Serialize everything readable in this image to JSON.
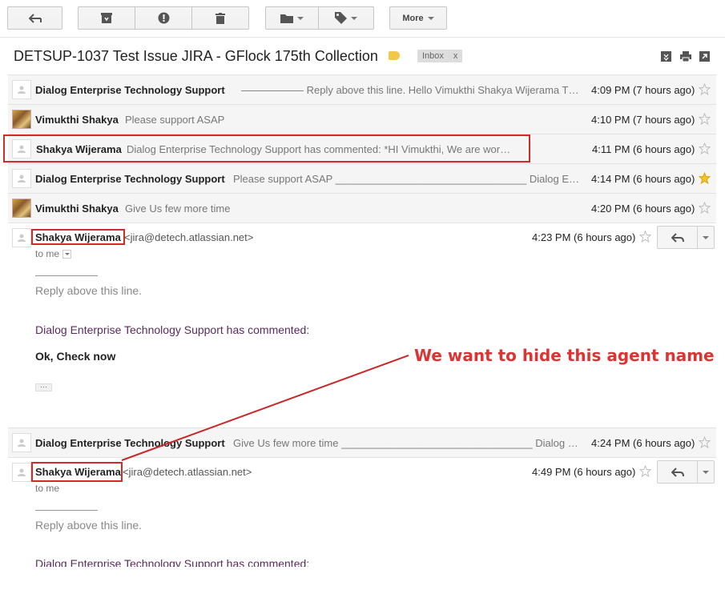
{
  "toolbar": {
    "more_label": "More"
  },
  "subject": "DETSUP-1037 Test Issue JIRA - GFlock 175th Collection",
  "label": {
    "inbox": "Inbox",
    "remove": "x"
  },
  "rows": [
    {
      "sender": "Dialog Enterprise Technology Support",
      "snippet": "—————— Reply above this line. Hello Vimukthi Shakya Wijerama Thank you for your",
      "time": "4:09 PM (7 hours ago)",
      "starred": false
    },
    {
      "sender": "Vimukthi Shakya",
      "snippet": "Please support ASAP",
      "time": "4:10 PM (7 hours ago)",
      "starred": false
    },
    {
      "sender": "Shakya Wijerama",
      "snippet": "Dialog Enterprise Technology Support has commented: *HI Vimukthi, We are working on it*",
      "time": "4:11 PM (6 hours ago)",
      "starred": false
    },
    {
      "sender": "Dialog Enterprise Technology Support",
      "snippet": "Please support ASAP _________________________________ Dialog Enterprise Technology",
      "time": "4:14 PM (6 hours ago)",
      "starred": true
    },
    {
      "sender": "Vimukthi Shakya",
      "snippet": "Give Us few more time",
      "time": "4:20 PM (6 hours ago)",
      "starred": false
    }
  ],
  "message1": {
    "sender": "Shakya Wijerama",
    "email": "<jira@detech.atlassian.net>",
    "time": "4:23 PM (6 hours ago)",
    "to": "to me",
    "separator": "——————",
    "reply_above": "Reply above this line.",
    "commented": "Dialog Enterprise Technology Support has commented:",
    "body": "Ok, Check now",
    "trimmed": "···"
  },
  "row6": {
    "sender": "Dialog Enterprise Technology Support",
    "snippet": "Give Us few more time _________________________________ Dialog Enterprise",
    "time": "4:24 PM (6 hours ago)"
  },
  "message2": {
    "sender": "Shakya Wijerama",
    "email": "<jira@detech.atlassian.net>",
    "time": "4:49 PM (6 hours ago)",
    "to": "to me",
    "separator": "——————",
    "reply_above": "Reply above this line.",
    "commented": "Dialog Enterprise Technology Support has commented:"
  },
  "annotation": {
    "text": "We want to hide this agent name",
    "color": "#d33333"
  },
  "colors": {
    "star_active": "#f4c430",
    "label": "#f2c84b"
  }
}
